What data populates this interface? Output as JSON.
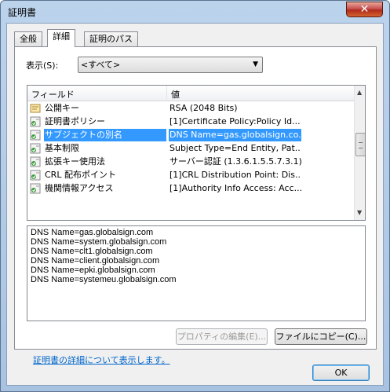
{
  "window": {
    "title": "証明書",
    "close_glyph": "✕"
  },
  "tabs": [
    {
      "label": "全般"
    },
    {
      "label": "詳細"
    },
    {
      "label": "証明のパス"
    }
  ],
  "show": {
    "label": "表示(S):",
    "selected": "<すべて>"
  },
  "list": {
    "columns": [
      "フィールド",
      "値"
    ],
    "rows": [
      {
        "field": "公開キー",
        "value": "RSA (2048 Bits)",
        "icon": "certificate-field-icon"
      },
      {
        "field": "証明書ポリシー",
        "value": "[1]Certificate Policy:Policy Id...",
        "icon": "extension-icon"
      },
      {
        "field": "サブジェクトの別名",
        "value": "DNS Name=gas.globalsign.co...",
        "icon": "extension-icon"
      },
      {
        "field": "基本制限",
        "value": "Subject Type=End Entity, Pat...",
        "icon": "extension-icon"
      },
      {
        "field": "拡張キー使用法",
        "value": "サーバー認証 (1.3.6.1.5.5.7.3.1), ...",
        "icon": "extension-icon"
      },
      {
        "field": "CRL 配布ポイント",
        "value": "[1]CRL Distribution Point: Dis...",
        "icon": "extension-icon"
      },
      {
        "field": "機関情報アクセス",
        "value": "[1]Authority Info Access: Acc...",
        "icon": "extension-icon"
      }
    ],
    "selected_index": 2
  },
  "detail": {
    "lines": [
      "DNS Name=gas.globalsign.com",
      "DNS Name=system.globalsign.com",
      "DNS Name=clt1.globalsign.com",
      "DNS Name=client.globalsign.com",
      "DNS Name=epki.globalsign.com",
      "DNS Name=systemeu.globalsign.com"
    ]
  },
  "buttons": {
    "edit_properties": "プロパティの編集(E)...",
    "copy_to_file": "ファイルにコピー(C)...",
    "ok": "OK"
  },
  "link": {
    "text": "証明書の詳細について表示します。"
  },
  "colors": {
    "selection": "#3399ff",
    "link": "#0066cc"
  }
}
